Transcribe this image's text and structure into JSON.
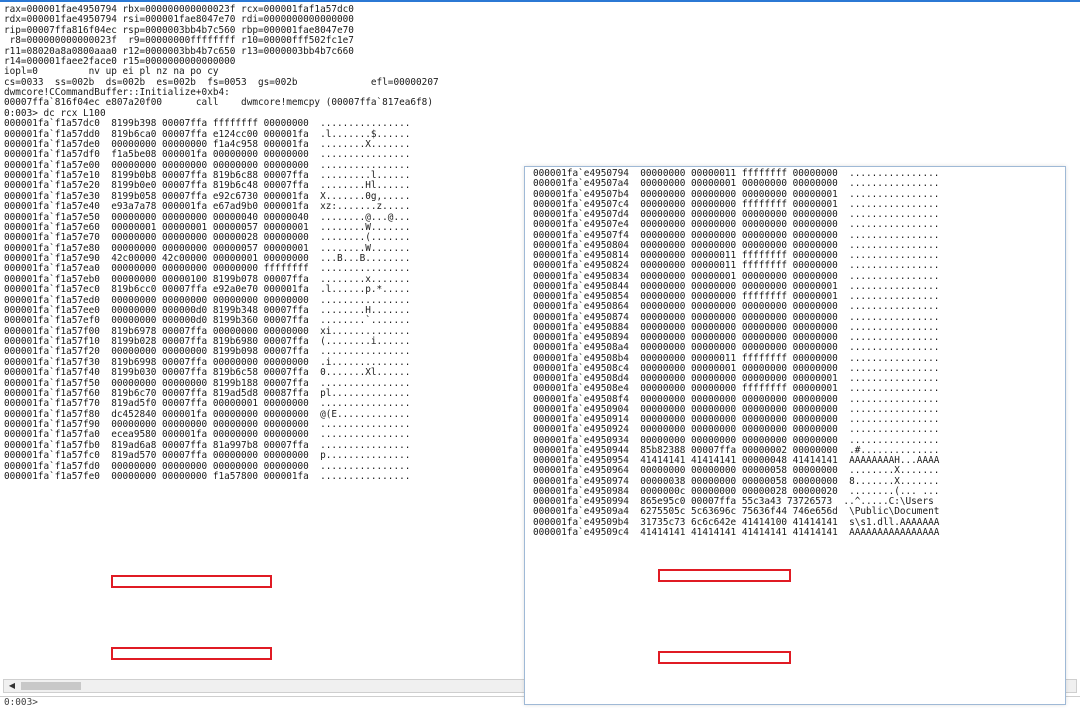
{
  "registers": [
    "rax=000001fae4950794 rbx=000000000000023f rcx=000001faf1a57dc0",
    "rdx=000001fae4950794 rsi=000001fae8047e70 rdi=0000000000000000",
    "rip=00007ffa816f04ec rsp=0000003bb4b7c560 rbp=000001fae8047e70",
    " r8=000000000000023f  r9=00000000ffffffff r10=00000fff502fc1e7",
    "r11=08020a8a0800aaa0 r12=0000003bb4b7c650 r13=0000003bb4b7c660",
    "r14=000001faee2face0 r15=0000000000000000",
    "iopl=0         nv up ei pl nz na po cy",
    "cs=0033  ss=002b  ds=002b  es=002b  fs=0053  gs=002b             efl=00000207",
    "dwmcore!CCommandBuffer::Initialize+0xb4:",
    "00007ffa`816f04ec e807a20f00      call    dwmcore!memcpy (00007ffa`817ea6f8)",
    "0:003> dc rcx L100"
  ],
  "left_dump": [
    "000001fa`f1a57dc0  8199b398 00007ffa ffffffff 00000000  ................",
    "000001fa`f1a57dd0  819b6ca0 00007ffa e124cc00 000001fa  .l.......$......",
    "000001fa`f1a57de0  00000000 00000000 f1a4c958 000001fa  ........X.......",
    "000001fa`f1a57df0  f1a5be08 000001fa 00000000 00000000  ................",
    "000001fa`f1a57e00  00000000 00000000 00000000 00000000  ................",
    "000001fa`f1a57e10  8199b0b8 00007ffa 819b6c88 00007ffa  .........l......",
    "000001fa`f1a57e20  8199b0e0 00007ffa 819b6c48 00007ffa  ........Hl......",
    "000001fa`f1a57e30  8199b058 00007ffa e92c6730 000001fa  X.......0g,.....",
    "000001fa`f1a57e40  e93a7a78 000001fa e67ad9b0 000001fa  xz:.......z.....",
    "000001fa`f1a57e50  00000000 00000000 00000040 00000040  ........@...@...",
    "000001fa`f1a57e60  00000001 00000001 00000057 00000001  ........W.......",
    "000001fa`f1a57e70  00000000 00000000 00000028 00000000  ........(.......",
    "000001fa`f1a57e80  00000000 00000000 00000057 00000001  ........W.......",
    "000001fa`f1a57e90  42c00000 42c00000 00000001 00000000  ...B...B........",
    "000001fa`f1a57ea0  00000000 00000000 00000000 ffffffff  ................",
    "000001fa`f1a57eb0  00000000 00000100 8199b078 00007ffa  ........x.......",
    "000001fa`f1a57ec0  819b6cc0 00007ffa e92a0e70 000001fa  .l......p.*.....",
    "000001fa`f1a57ed0  00000000 00000000 00000000 00000000  ................",
    "000001fa`f1a57ee0  00000000 000000d0 8199b348 00007ffa  ........H.......",
    "000001fa`f1a57ef0  00000000 000000d0 8199b360 00007ffa  ........`.......",
    "000001fa`f1a57f00  819b6978 00007ffa 00000000 00000000  xi..............",
    "000001fa`f1a57f10  8199b028 00007ffa 819b6980 00007ffa  (........i......",
    "000001fa`f1a57f20  00000000 00000000 8199b098 00007ffa  ................",
    "000001fa`f1a57f30  819b6998 00007ffa 00000000 00000000  .i..............",
    "000001fa`f1a57f40  8199b030 00007ffa 819b6c58 00007ffa  0.......Xl......",
    "000001fa`f1a57f50  00000000 00000000 8199b188 00007ffa  ................",
    "000001fa`f1a57f60  819b6c70 00007ffa 819ad5d8 00087ffa  pl..............",
    "000001fa`f1a57f70  819ad5f0 00007ffa 00000001 00000000  ................",
    "000001fa`f1a57f80  dc452840 000001fa 00000000 00000000  @(E.............",
    "000001fa`f1a57f90  00000000 00000000 00000000 00000000  ................",
    "000001fa`f1a57fa0  ecea9580 000001fa 00000000 00000000  ................",
    "000001fa`f1a57fb0  819ad6a8 00007ffa 81a997b8 00007ffa  ................",
    "000001fa`f1a57fc0  819ad570 00007ffa 00000000 00000000  p...............",
    "000001fa`f1a57fd0  00000000 00000000 00000000 00000000  ................",
    "000001fa`f1a57fe0  00000000 00000000 f1a57800 000001fa  ................"
  ],
  "right_dump": [
    "000001fa`e4950794  00000000 00000011 ffffffff 00000000  ................",
    "000001fa`e49507a4  00000000 00000001 00000000 00000000  ................",
    "000001fa`e49507b4  00000000 00000000 00000000 00000001  ................",
    "000001fa`e49507c4  00000000 00000000 ffffffff 00000001  ................",
    "000001fa`e49507d4  00000000 00000000 00000000 00000000  ................",
    "000001fa`e49507e4  00000000 00000000 00000000 00000000  ................",
    "000001fa`e49507f4  00000000 00000000 00000000 00000000  ................",
    "000001fa`e4950804  00000000 00000000 00000000 00000000  ................",
    "000001fa`e4950814  00000000 00000011 ffffffff 00000000  ................",
    "000001fa`e4950824  00000000 00000011 ffffffff 00000000  ................",
    "000001fa`e4950834  00000000 00000001 00000000 00000000  ................",
    "000001fa`e4950844  00000000 00000000 00000000 00000001  ................",
    "000001fa`e4950854  00000000 00000000 ffffffff 00000001  ................",
    "000001fa`e4950864  00000000 00000000 00000000 00000000  ................",
    "000001fa`e4950874  00000000 00000000 00000000 00000000  ................",
    "000001fa`e4950884  00000000 00000000 00000000 00000000  ................",
    "000001fa`e4950894  00000000 00000000 00000000 00000000  ................",
    "000001fa`e49508a4  00000000 00000000 00000000 00000000  ................",
    "000001fa`e49508b4  00000000 00000011 ffffffff 00000000  ................",
    "000001fa`e49508c4  00000000 00000001 00000000 00000000  ................",
    "000001fa`e49508d4  00000000 00000000 00000000 00000001  ................",
    "000001fa`e49508e4  00000000 00000000 ffffffff 00000001  ................",
    "000001fa`e49508f4  00000000 00000000 00000000 00000000  ................",
    "000001fa`e4950904  00000000 00000000 00000000 00000000  ................",
    "000001fa`e4950914  00000000 00000000 00000000 00000000  ................",
    "000001fa`e4950924  00000000 00000000 00000000 00000000  ................",
    "000001fa`e4950934  00000000 00000000 00000000 00000000  ................",
    "000001fa`e4950944  85b82388 00007ffa 00000002 00000000  .#..............",
    "000001fa`e4950954  41414141 41414141 00000048 41414141  AAAAAAAAH...AAAA",
    "000001fa`e4950964  00000000 00000000 00000058 00000000  ........X.......",
    "000001fa`e4950974  00000038 00000000 00000058 00000000  8.......X.......",
    "000001fa`e4950984  0000000c 00000000 00000028 00000020  ........(... ...",
    "000001fa`e4950994  865e95c0 00007ffa 55c3a43 73726573  ..^.....C:\\Users",
    "000001fa`e49509a4  6275505c 5c63696c 75636f44 746e656d  \\Public\\Document",
    "000001fa`e49509b4  31735c73 6c6c642e 41414100 41414141  s\\s1.dll.AAAAAAA",
    "000001fa`e49509c4  41414141 41414141 41414141 41414141  AAAAAAAAAAAAAAAA"
  ],
  "command_prompt": "0:003>",
  "scroll_left_glyph": "◀",
  "highlight_color": "#e01b24"
}
